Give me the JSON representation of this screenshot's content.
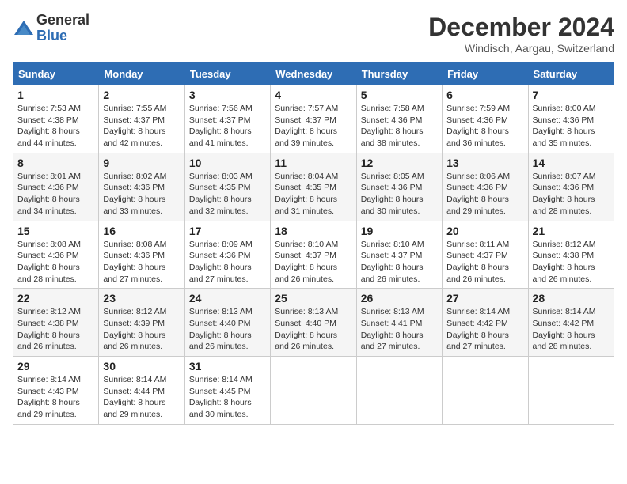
{
  "header": {
    "logo_general": "General",
    "logo_blue": "Blue",
    "month_title": "December 2024",
    "location": "Windisch, Aargau, Switzerland"
  },
  "days_of_week": [
    "Sunday",
    "Monday",
    "Tuesday",
    "Wednesday",
    "Thursday",
    "Friday",
    "Saturday"
  ],
  "weeks": [
    [
      {
        "day": "1",
        "sunrise": "7:53 AM",
        "sunset": "4:38 PM",
        "daylight": "8 hours and 44 minutes."
      },
      {
        "day": "2",
        "sunrise": "7:55 AM",
        "sunset": "4:37 PM",
        "daylight": "8 hours and 42 minutes."
      },
      {
        "day": "3",
        "sunrise": "7:56 AM",
        "sunset": "4:37 PM",
        "daylight": "8 hours and 41 minutes."
      },
      {
        "day": "4",
        "sunrise": "7:57 AM",
        "sunset": "4:37 PM",
        "daylight": "8 hours and 39 minutes."
      },
      {
        "day": "5",
        "sunrise": "7:58 AM",
        "sunset": "4:36 PM",
        "daylight": "8 hours and 38 minutes."
      },
      {
        "day": "6",
        "sunrise": "7:59 AM",
        "sunset": "4:36 PM",
        "daylight": "8 hours and 36 minutes."
      },
      {
        "day": "7",
        "sunrise": "8:00 AM",
        "sunset": "4:36 PM",
        "daylight": "8 hours and 35 minutes."
      }
    ],
    [
      {
        "day": "8",
        "sunrise": "8:01 AM",
        "sunset": "4:36 PM",
        "daylight": "8 hours and 34 minutes."
      },
      {
        "day": "9",
        "sunrise": "8:02 AM",
        "sunset": "4:36 PM",
        "daylight": "8 hours and 33 minutes."
      },
      {
        "day": "10",
        "sunrise": "8:03 AM",
        "sunset": "4:35 PM",
        "daylight": "8 hours and 32 minutes."
      },
      {
        "day": "11",
        "sunrise": "8:04 AM",
        "sunset": "4:35 PM",
        "daylight": "8 hours and 31 minutes."
      },
      {
        "day": "12",
        "sunrise": "8:05 AM",
        "sunset": "4:36 PM",
        "daylight": "8 hours and 30 minutes."
      },
      {
        "day": "13",
        "sunrise": "8:06 AM",
        "sunset": "4:36 PM",
        "daylight": "8 hours and 29 minutes."
      },
      {
        "day": "14",
        "sunrise": "8:07 AM",
        "sunset": "4:36 PM",
        "daylight": "8 hours and 28 minutes."
      }
    ],
    [
      {
        "day": "15",
        "sunrise": "8:08 AM",
        "sunset": "4:36 PM",
        "daylight": "8 hours and 28 minutes."
      },
      {
        "day": "16",
        "sunrise": "8:08 AM",
        "sunset": "4:36 PM",
        "daylight": "8 hours and 27 minutes."
      },
      {
        "day": "17",
        "sunrise": "8:09 AM",
        "sunset": "4:36 PM",
        "daylight": "8 hours and 27 minutes."
      },
      {
        "day": "18",
        "sunrise": "8:10 AM",
        "sunset": "4:37 PM",
        "daylight": "8 hours and 26 minutes."
      },
      {
        "day": "19",
        "sunrise": "8:10 AM",
        "sunset": "4:37 PM",
        "daylight": "8 hours and 26 minutes."
      },
      {
        "day": "20",
        "sunrise": "8:11 AM",
        "sunset": "4:37 PM",
        "daylight": "8 hours and 26 minutes."
      },
      {
        "day": "21",
        "sunrise": "8:12 AM",
        "sunset": "4:38 PM",
        "daylight": "8 hours and 26 minutes."
      }
    ],
    [
      {
        "day": "22",
        "sunrise": "8:12 AM",
        "sunset": "4:38 PM",
        "daylight": "8 hours and 26 minutes."
      },
      {
        "day": "23",
        "sunrise": "8:12 AM",
        "sunset": "4:39 PM",
        "daylight": "8 hours and 26 minutes."
      },
      {
        "day": "24",
        "sunrise": "8:13 AM",
        "sunset": "4:40 PM",
        "daylight": "8 hours and 26 minutes."
      },
      {
        "day": "25",
        "sunrise": "8:13 AM",
        "sunset": "4:40 PM",
        "daylight": "8 hours and 26 minutes."
      },
      {
        "day": "26",
        "sunrise": "8:13 AM",
        "sunset": "4:41 PM",
        "daylight": "8 hours and 27 minutes."
      },
      {
        "day": "27",
        "sunrise": "8:14 AM",
        "sunset": "4:42 PM",
        "daylight": "8 hours and 27 minutes."
      },
      {
        "day": "28",
        "sunrise": "8:14 AM",
        "sunset": "4:42 PM",
        "daylight": "8 hours and 28 minutes."
      }
    ],
    [
      {
        "day": "29",
        "sunrise": "8:14 AM",
        "sunset": "4:43 PM",
        "daylight": "8 hours and 29 minutes."
      },
      {
        "day": "30",
        "sunrise": "8:14 AM",
        "sunset": "4:44 PM",
        "daylight": "8 hours and 29 minutes."
      },
      {
        "day": "31",
        "sunrise": "8:14 AM",
        "sunset": "4:45 PM",
        "daylight": "8 hours and 30 minutes."
      },
      null,
      null,
      null,
      null
    ]
  ],
  "labels": {
    "sunrise": "Sunrise:",
    "sunset": "Sunset:",
    "daylight": "Daylight:"
  }
}
